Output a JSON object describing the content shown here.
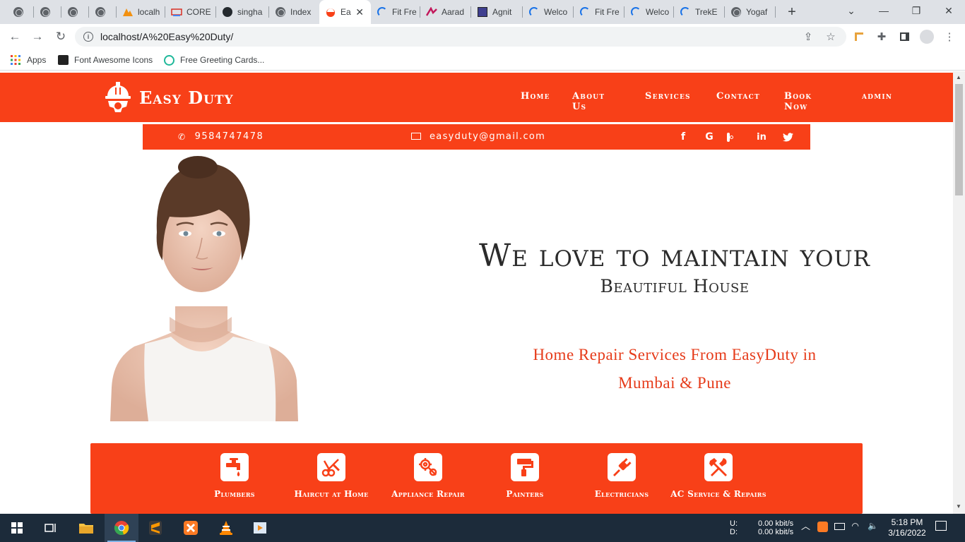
{
  "browser": {
    "tabs": [
      {
        "title": "",
        "icon": "globe-icon"
      },
      {
        "title": "",
        "icon": "globe-icon"
      },
      {
        "title": "",
        "icon": "globe-icon"
      },
      {
        "title": "",
        "icon": "globe-icon"
      },
      {
        "title": "localh",
        "icon": "phpmyadmin-icon"
      },
      {
        "title": "CORE",
        "icon": "core-icon"
      },
      {
        "title": "singha",
        "icon": "github-icon"
      },
      {
        "title": "Index",
        "icon": "globe-icon"
      },
      {
        "title": "Ea",
        "icon": "easyduty-icon",
        "active": true
      },
      {
        "title": "Fit Fre",
        "icon": "loading-icon"
      },
      {
        "title": "Aarad",
        "icon": "aarad-icon"
      },
      {
        "title": "Agnit",
        "icon": "agnit-icon"
      },
      {
        "title": "Welco",
        "icon": "loading-icon"
      },
      {
        "title": "Fit Fre",
        "icon": "loading-icon"
      },
      {
        "title": "Welco",
        "icon": "loading-icon"
      },
      {
        "title": "TrekE",
        "icon": "loading-icon"
      },
      {
        "title": "Yogaf",
        "icon": "globe-icon"
      }
    ],
    "url": "localhost/A%20Easy%20Duty/",
    "bookmarks": [
      {
        "label": "Apps",
        "icon": "apps-grid-icon"
      },
      {
        "label": "Font Awesome Icons",
        "icon": "flag-icon"
      },
      {
        "label": "Free Greeting Cards...",
        "icon": "greeting-icon"
      }
    ]
  },
  "site": {
    "brand": "Easy Duty",
    "nav": [
      "Home",
      "About Us",
      "Services",
      "Contact",
      "Book Now",
      "admin"
    ],
    "phone": "9584747478",
    "email": "easyduty@gmail.com",
    "social": [
      "facebook-icon",
      "google-icon",
      "instagram-icon",
      "linkedin-icon",
      "twitter-icon"
    ],
    "hero": {
      "title": "We love to maintain your",
      "subtitle": "Beautiful House",
      "tagline_line1": "Home Repair Services From EasyDuty in",
      "tagline_line2": "Mumbai & Pune"
    },
    "services": [
      {
        "label": "Plumbers",
        "icon": "faucet-icon"
      },
      {
        "label": "Haircut at Home",
        "icon": "scissors-comb-icon"
      },
      {
        "label": "Appliance Repair",
        "icon": "gear-wrench-icon"
      },
      {
        "label": "Painters",
        "icon": "paint-roller-icon"
      },
      {
        "label": "Electricians",
        "icon": "plug-icon"
      },
      {
        "label": "AC Service & Repairs",
        "icon": "tools-icon"
      }
    ],
    "colors": {
      "accent": "#f84018",
      "hero_text": "#2b2b2b",
      "tagline": "#e63b1a"
    }
  },
  "taskbar": {
    "net_up_label": "U:",
    "net_down_label": "D:",
    "net_up": "0.00 kbit/s",
    "net_down": "0.00 kbit/s",
    "time": "5:18 PM",
    "date": "3/16/2022"
  }
}
